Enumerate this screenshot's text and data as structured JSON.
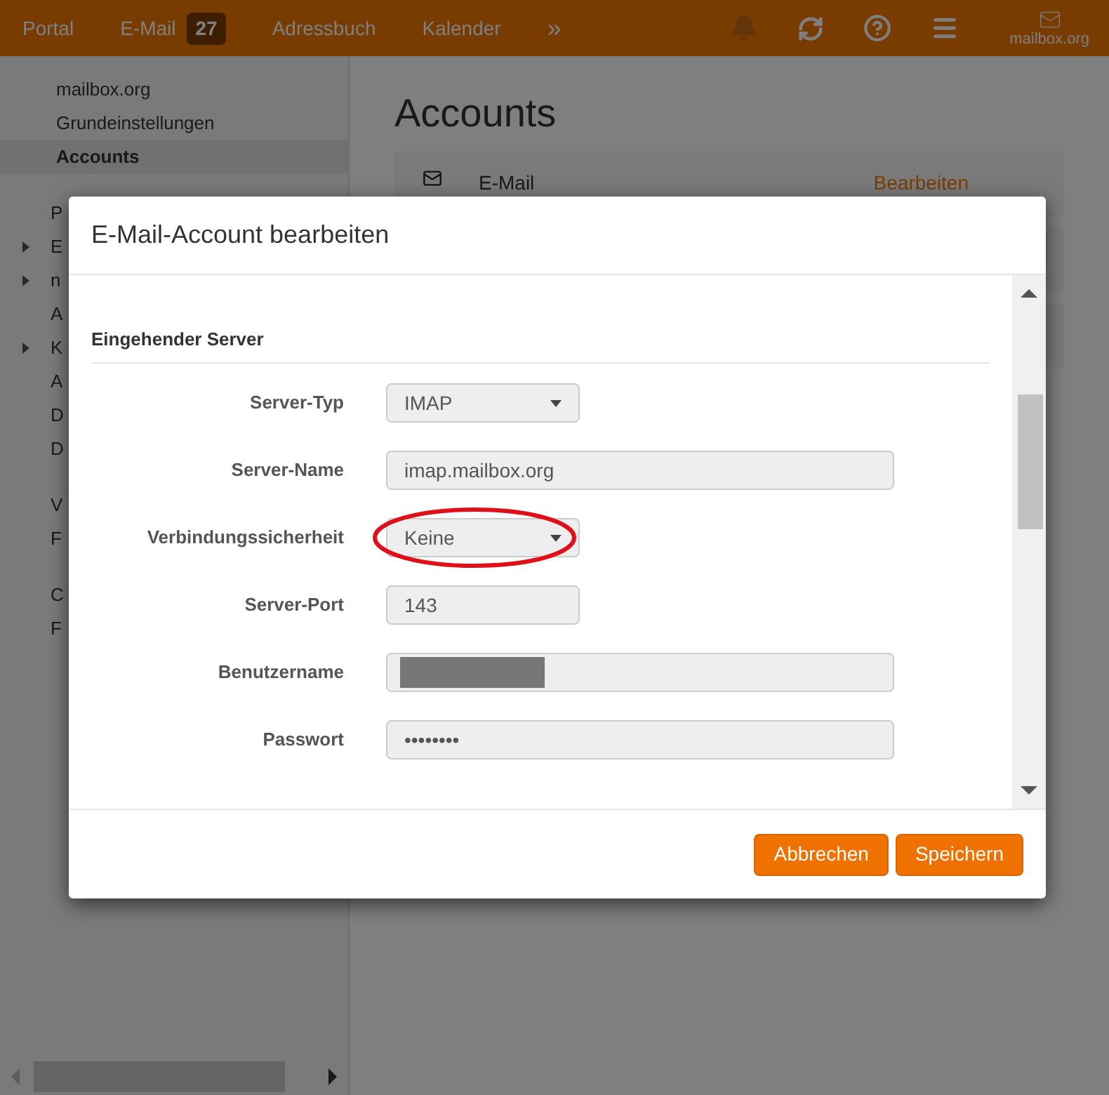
{
  "topbar": {
    "items": [
      {
        "label": "Portal"
      },
      {
        "label": "E-Mail",
        "badge": "27"
      },
      {
        "label": "Adressbuch"
      },
      {
        "label": "Kalender"
      },
      {
        "label": "»"
      }
    ],
    "logo_text": "mailbox.org"
  },
  "sidebar": {
    "groups": [
      [
        {
          "label": "mailbox.org",
          "selected": false,
          "expandable": false
        },
        {
          "label": "Grundeinstellungen",
          "selected": false,
          "expandable": false
        },
        {
          "label": "Accounts",
          "selected": true,
          "expandable": false
        }
      ],
      [
        {
          "label": "P",
          "selected": false,
          "expandable": false
        },
        {
          "label": "E",
          "selected": false,
          "expandable": true
        },
        {
          "label": "n",
          "selected": false,
          "expandable": true
        },
        {
          "label": "A",
          "selected": false,
          "expandable": false
        },
        {
          "label": "K",
          "selected": false,
          "expandable": true
        },
        {
          "label": "A",
          "selected": false,
          "expandable": false
        },
        {
          "label": "D",
          "selected": false,
          "expandable": false
        },
        {
          "label": "D",
          "selected": false,
          "expandable": false
        }
      ],
      [
        {
          "label": "V",
          "selected": false,
          "expandable": false
        },
        {
          "label": "F",
          "selected": false,
          "expandable": false
        }
      ],
      [
        {
          "label": "C",
          "selected": false,
          "expandable": false
        },
        {
          "label": "F",
          "selected": false,
          "expandable": false
        }
      ]
    ]
  },
  "main": {
    "title": "Accounts",
    "accounts": [
      {
        "name": "E-Mail",
        "action": "Bearbeiten"
      }
    ]
  },
  "dialog": {
    "title": "E-Mail-Account bearbeiten",
    "section": "Eingehender Server",
    "fields": [
      {
        "label": "Server-Typ",
        "kind": "select",
        "value": "IMAP",
        "highlighted": false
      },
      {
        "label": "Server-Name",
        "kind": "text",
        "value": "imap.mailbox.org",
        "highlighted": false
      },
      {
        "label": "Verbindungssicherheit",
        "kind": "select",
        "value": "Keine",
        "highlighted": true
      },
      {
        "label": "Server-Port",
        "kind": "short",
        "value": "143",
        "highlighted": false
      },
      {
        "label": "Benutzername",
        "kind": "redacted",
        "highlighted": false
      },
      {
        "label": "Passwort",
        "kind": "text",
        "value": "••••••••",
        "highlighted": false
      }
    ],
    "buttons": [
      "Abbrechen",
      "Speichern"
    ]
  }
}
